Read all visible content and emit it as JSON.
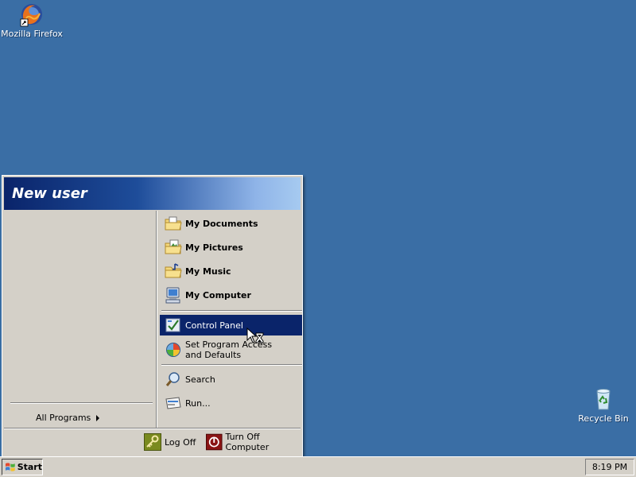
{
  "desktop": {
    "icons": [
      {
        "label": "Mozilla Firefox",
        "icon": "firefox-icon"
      },
      {
        "label": "Recycle Bin",
        "icon": "recycle-bin-icon"
      }
    ],
    "background_color": "#3A6EA5"
  },
  "start_menu": {
    "user_name": "New user",
    "all_programs_label": "All Programs",
    "right_items": [
      {
        "label": "My Documents",
        "icon": "my-documents-icon"
      },
      {
        "label": "My Pictures",
        "icon": "my-pictures-icon"
      },
      {
        "label": "My Music",
        "icon": "my-music-icon"
      },
      {
        "label": "My Computer",
        "icon": "my-computer-icon"
      },
      {
        "label": "Control Panel",
        "icon": "control-panel-icon",
        "highlighted": true
      },
      {
        "label": "Set Program Access and Defaults",
        "icon": "program-access-icon"
      },
      {
        "label": "Search",
        "icon": "search-icon"
      },
      {
        "label": "Run...",
        "icon": "run-icon"
      }
    ],
    "footer": {
      "log_off_label": "Log Off",
      "turn_off_label": "Turn Off Computer"
    },
    "highlight_color": "#0A246A"
  },
  "taskbar": {
    "start_label": "Start",
    "clock": "8:19 PM"
  }
}
